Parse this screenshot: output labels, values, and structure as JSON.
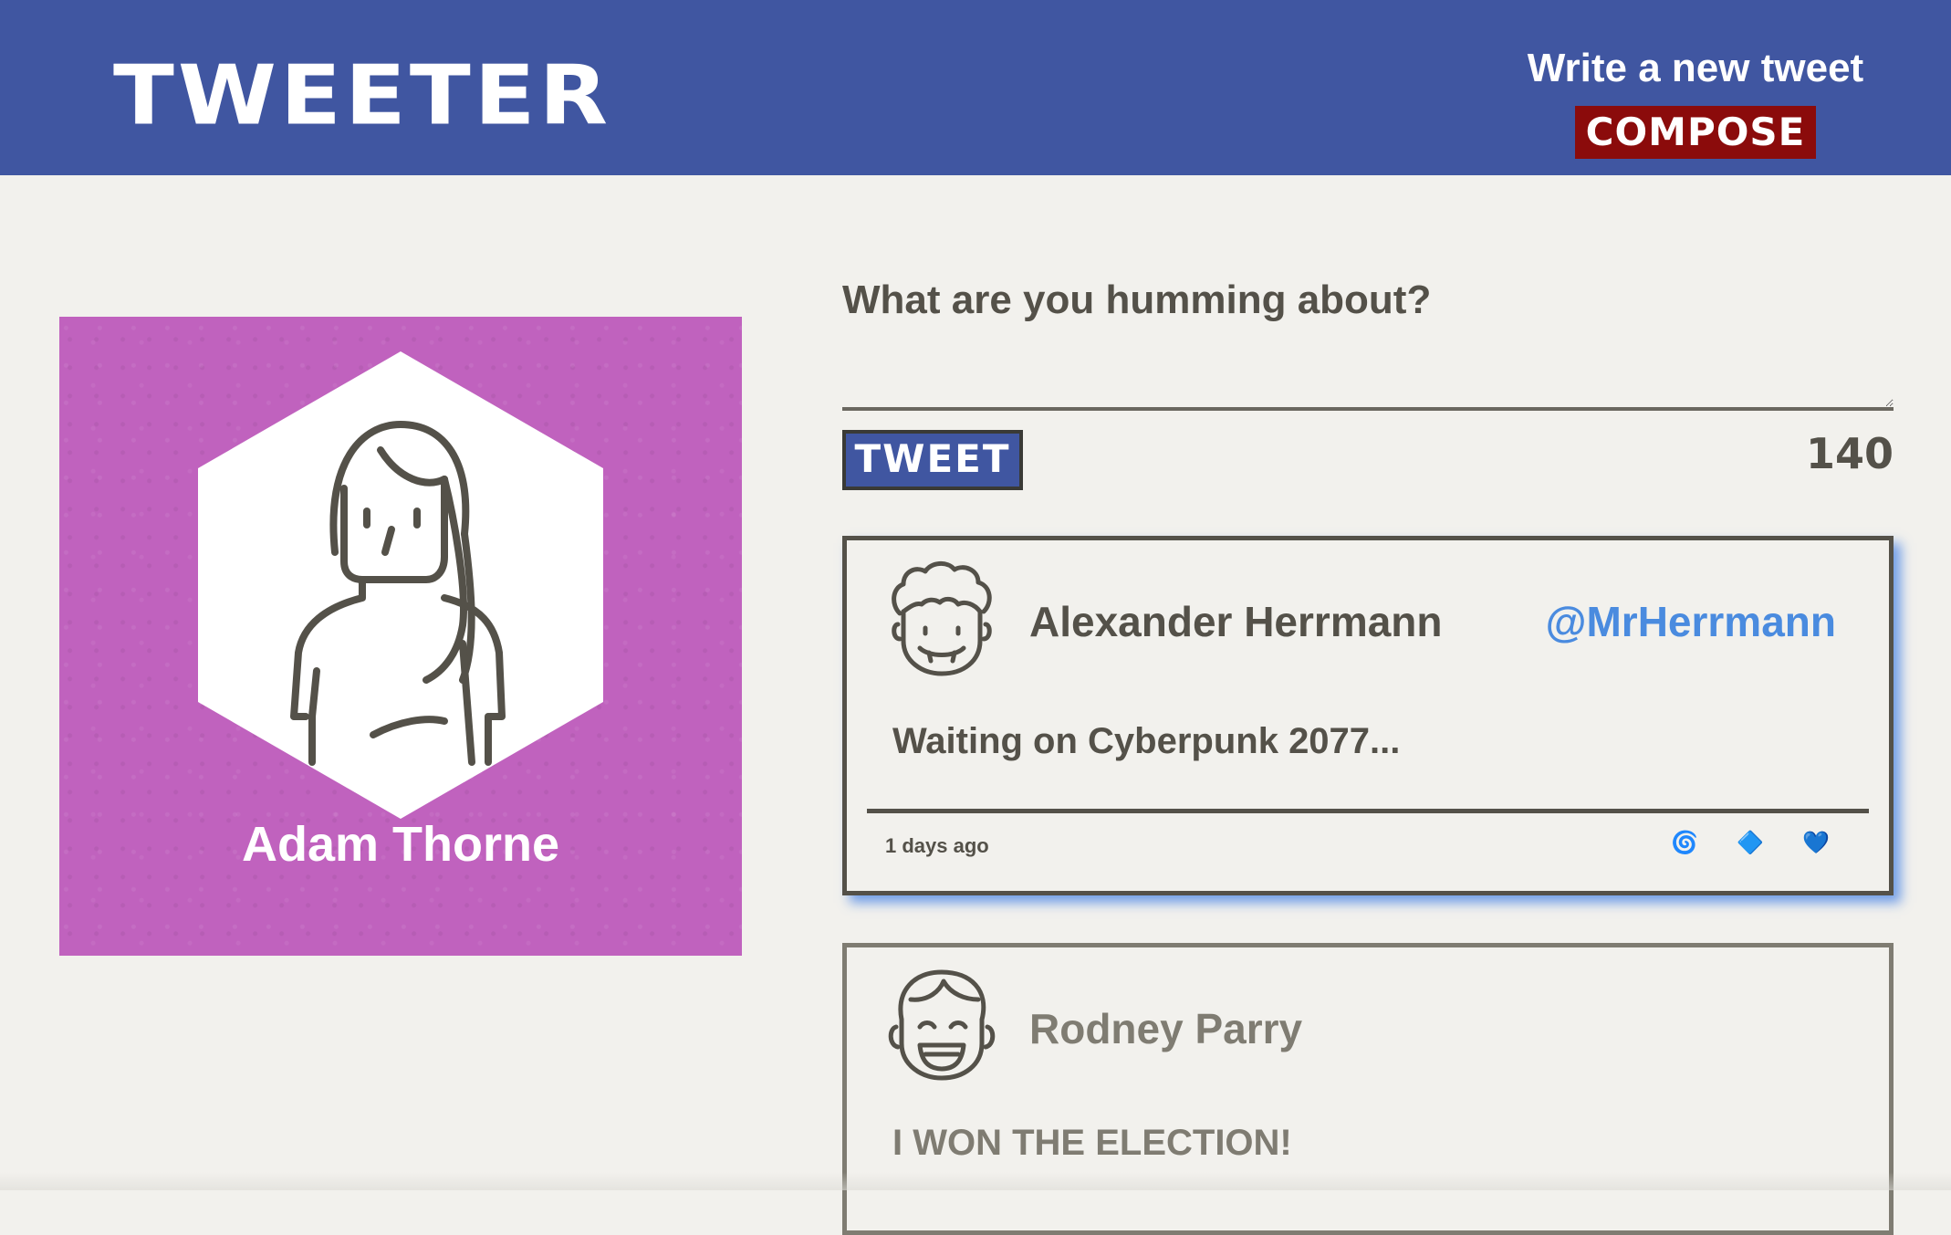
{
  "header": {
    "logo": "TWEETER",
    "compose_prompt": "Write a new tweet",
    "compose_button": "COMPOSE"
  },
  "profile": {
    "name": "Adam Thorne",
    "card_color": "#c062be",
    "avatar_icon": "woman-avatar-icon"
  },
  "composer": {
    "prompt": "What are you humming about?",
    "tweet_button": "TWEET",
    "char_count": "140"
  },
  "tweets": [
    {
      "author": "Alexander Herrmann",
      "handle": "@MrHerrmann",
      "content": "Waiting on Cyberpunk 2077...",
      "timestamp": "1 days ago",
      "avatar_icon": "curly-hair-man-avatar-icon",
      "actions": [
        {
          "icon": "retweet-swirl-icon",
          "glyph": "🌀"
        },
        {
          "icon": "flag-diamond-icon",
          "glyph": "🔷"
        },
        {
          "icon": "like-heart-icon",
          "glyph": "💙"
        }
      ]
    },
    {
      "author": "Rodney Parry",
      "content": "I WON THE ELECTION!",
      "avatar_icon": "smiling-man-avatar-icon"
    }
  ],
  "colors": {
    "header_bg": "#4056a1",
    "compose_button_bg": "#8b0b0b",
    "page_bg": "#f2f1ed",
    "text": "#545149",
    "handle": "#4a8bdf",
    "tweet_shadow": "#4682e6"
  }
}
